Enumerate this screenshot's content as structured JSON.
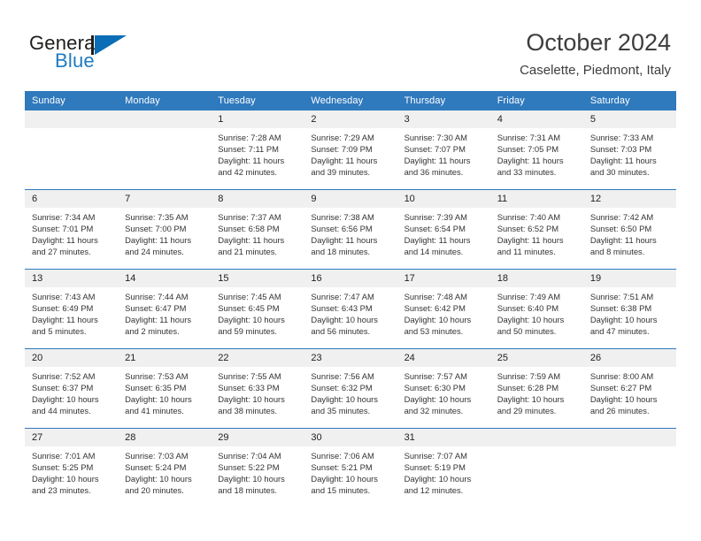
{
  "logo": {
    "word_one": "General",
    "word_two": "Blue",
    "mark_name": "general-blue-triangle-logo",
    "accent_color": "#0a6db5",
    "text_color": "#1d1d1b"
  },
  "header": {
    "title": "October 2024",
    "subtitle": "Caselette, Piedmont, Italy"
  },
  "theme": {
    "header_row_bg": "#2f79bd",
    "header_row_text": "#ffffff",
    "daynum_bg": "#f0f0f0",
    "rule_color": "#2f79bd",
    "body_text": "#333333"
  },
  "weekday_headers": [
    "Sunday",
    "Monday",
    "Tuesday",
    "Wednesday",
    "Thursday",
    "Friday",
    "Saturday"
  ],
  "weeks": [
    [
      {
        "day": "",
        "empty": true,
        "sunrise": "",
        "sunset": "",
        "daylight_line1": "",
        "daylight_line2": ""
      },
      {
        "day": "",
        "empty": true,
        "sunrise": "",
        "sunset": "",
        "daylight_line1": "",
        "daylight_line2": ""
      },
      {
        "day": "1",
        "empty": false,
        "sunrise": "Sunrise: 7:28 AM",
        "sunset": "Sunset: 7:11 PM",
        "daylight_line1": "Daylight: 11 hours",
        "daylight_line2": "and 42 minutes."
      },
      {
        "day": "2",
        "empty": false,
        "sunrise": "Sunrise: 7:29 AM",
        "sunset": "Sunset: 7:09 PM",
        "daylight_line1": "Daylight: 11 hours",
        "daylight_line2": "and 39 minutes."
      },
      {
        "day": "3",
        "empty": false,
        "sunrise": "Sunrise: 7:30 AM",
        "sunset": "Sunset: 7:07 PM",
        "daylight_line1": "Daylight: 11 hours",
        "daylight_line2": "and 36 minutes."
      },
      {
        "day": "4",
        "empty": false,
        "sunrise": "Sunrise: 7:31 AM",
        "sunset": "Sunset: 7:05 PM",
        "daylight_line1": "Daylight: 11 hours",
        "daylight_line2": "and 33 minutes."
      },
      {
        "day": "5",
        "empty": false,
        "sunrise": "Sunrise: 7:33 AM",
        "sunset": "Sunset: 7:03 PM",
        "daylight_line1": "Daylight: 11 hours",
        "daylight_line2": "and 30 minutes."
      }
    ],
    [
      {
        "day": "6",
        "empty": false,
        "sunrise": "Sunrise: 7:34 AM",
        "sunset": "Sunset: 7:01 PM",
        "daylight_line1": "Daylight: 11 hours",
        "daylight_line2": "and 27 minutes."
      },
      {
        "day": "7",
        "empty": false,
        "sunrise": "Sunrise: 7:35 AM",
        "sunset": "Sunset: 7:00 PM",
        "daylight_line1": "Daylight: 11 hours",
        "daylight_line2": "and 24 minutes."
      },
      {
        "day": "8",
        "empty": false,
        "sunrise": "Sunrise: 7:37 AM",
        "sunset": "Sunset: 6:58 PM",
        "daylight_line1": "Daylight: 11 hours",
        "daylight_line2": "and 21 minutes."
      },
      {
        "day": "9",
        "empty": false,
        "sunrise": "Sunrise: 7:38 AM",
        "sunset": "Sunset: 6:56 PM",
        "daylight_line1": "Daylight: 11 hours",
        "daylight_line2": "and 18 minutes."
      },
      {
        "day": "10",
        "empty": false,
        "sunrise": "Sunrise: 7:39 AM",
        "sunset": "Sunset: 6:54 PM",
        "daylight_line1": "Daylight: 11 hours",
        "daylight_line2": "and 14 minutes."
      },
      {
        "day": "11",
        "empty": false,
        "sunrise": "Sunrise: 7:40 AM",
        "sunset": "Sunset: 6:52 PM",
        "daylight_line1": "Daylight: 11 hours",
        "daylight_line2": "and 11 minutes."
      },
      {
        "day": "12",
        "empty": false,
        "sunrise": "Sunrise: 7:42 AM",
        "sunset": "Sunset: 6:50 PM",
        "daylight_line1": "Daylight: 11 hours",
        "daylight_line2": "and 8 minutes."
      }
    ],
    [
      {
        "day": "13",
        "empty": false,
        "sunrise": "Sunrise: 7:43 AM",
        "sunset": "Sunset: 6:49 PM",
        "daylight_line1": "Daylight: 11 hours",
        "daylight_line2": "and 5 minutes."
      },
      {
        "day": "14",
        "empty": false,
        "sunrise": "Sunrise: 7:44 AM",
        "sunset": "Sunset: 6:47 PM",
        "daylight_line1": "Daylight: 11 hours",
        "daylight_line2": "and 2 minutes."
      },
      {
        "day": "15",
        "empty": false,
        "sunrise": "Sunrise: 7:45 AM",
        "sunset": "Sunset: 6:45 PM",
        "daylight_line1": "Daylight: 10 hours",
        "daylight_line2": "and 59 minutes."
      },
      {
        "day": "16",
        "empty": false,
        "sunrise": "Sunrise: 7:47 AM",
        "sunset": "Sunset: 6:43 PM",
        "daylight_line1": "Daylight: 10 hours",
        "daylight_line2": "and 56 minutes."
      },
      {
        "day": "17",
        "empty": false,
        "sunrise": "Sunrise: 7:48 AM",
        "sunset": "Sunset: 6:42 PM",
        "daylight_line1": "Daylight: 10 hours",
        "daylight_line2": "and 53 minutes."
      },
      {
        "day": "18",
        "empty": false,
        "sunrise": "Sunrise: 7:49 AM",
        "sunset": "Sunset: 6:40 PM",
        "daylight_line1": "Daylight: 10 hours",
        "daylight_line2": "and 50 minutes."
      },
      {
        "day": "19",
        "empty": false,
        "sunrise": "Sunrise: 7:51 AM",
        "sunset": "Sunset: 6:38 PM",
        "daylight_line1": "Daylight: 10 hours",
        "daylight_line2": "and 47 minutes."
      }
    ],
    [
      {
        "day": "20",
        "empty": false,
        "sunrise": "Sunrise: 7:52 AM",
        "sunset": "Sunset: 6:37 PM",
        "daylight_line1": "Daylight: 10 hours",
        "daylight_line2": "and 44 minutes."
      },
      {
        "day": "21",
        "empty": false,
        "sunrise": "Sunrise: 7:53 AM",
        "sunset": "Sunset: 6:35 PM",
        "daylight_line1": "Daylight: 10 hours",
        "daylight_line2": "and 41 minutes."
      },
      {
        "day": "22",
        "empty": false,
        "sunrise": "Sunrise: 7:55 AM",
        "sunset": "Sunset: 6:33 PM",
        "daylight_line1": "Daylight: 10 hours",
        "daylight_line2": "and 38 minutes."
      },
      {
        "day": "23",
        "empty": false,
        "sunrise": "Sunrise: 7:56 AM",
        "sunset": "Sunset: 6:32 PM",
        "daylight_line1": "Daylight: 10 hours",
        "daylight_line2": "and 35 minutes."
      },
      {
        "day": "24",
        "empty": false,
        "sunrise": "Sunrise: 7:57 AM",
        "sunset": "Sunset: 6:30 PM",
        "daylight_line1": "Daylight: 10 hours",
        "daylight_line2": "and 32 minutes."
      },
      {
        "day": "25",
        "empty": false,
        "sunrise": "Sunrise: 7:59 AM",
        "sunset": "Sunset: 6:28 PM",
        "daylight_line1": "Daylight: 10 hours",
        "daylight_line2": "and 29 minutes."
      },
      {
        "day": "26",
        "empty": false,
        "sunrise": "Sunrise: 8:00 AM",
        "sunset": "Sunset: 6:27 PM",
        "daylight_line1": "Daylight: 10 hours",
        "daylight_line2": "and 26 minutes."
      }
    ],
    [
      {
        "day": "27",
        "empty": false,
        "sunrise": "Sunrise: 7:01 AM",
        "sunset": "Sunset: 5:25 PM",
        "daylight_line1": "Daylight: 10 hours",
        "daylight_line2": "and 23 minutes."
      },
      {
        "day": "28",
        "empty": false,
        "sunrise": "Sunrise: 7:03 AM",
        "sunset": "Sunset: 5:24 PM",
        "daylight_line1": "Daylight: 10 hours",
        "daylight_line2": "and 20 minutes."
      },
      {
        "day": "29",
        "empty": false,
        "sunrise": "Sunrise: 7:04 AM",
        "sunset": "Sunset: 5:22 PM",
        "daylight_line1": "Daylight: 10 hours",
        "daylight_line2": "and 18 minutes."
      },
      {
        "day": "30",
        "empty": false,
        "sunrise": "Sunrise: 7:06 AM",
        "sunset": "Sunset: 5:21 PM",
        "daylight_line1": "Daylight: 10 hours",
        "daylight_line2": "and 15 minutes."
      },
      {
        "day": "31",
        "empty": false,
        "sunrise": "Sunrise: 7:07 AM",
        "sunset": "Sunset: 5:19 PM",
        "daylight_line1": "Daylight: 10 hours",
        "daylight_line2": "and 12 minutes."
      },
      {
        "day": "",
        "empty": true,
        "sunrise": "",
        "sunset": "",
        "daylight_line1": "",
        "daylight_line2": ""
      },
      {
        "day": "",
        "empty": true,
        "sunrise": "",
        "sunset": "",
        "daylight_line1": "",
        "daylight_line2": ""
      }
    ]
  ]
}
